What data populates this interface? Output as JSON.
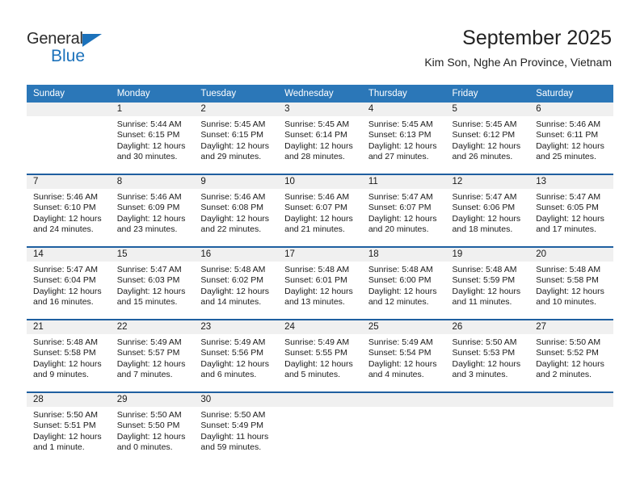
{
  "brand": {
    "name_top": "General",
    "name_bottom": "Blue",
    "triangle_color": "#1c72bb",
    "text_color": "#2b2b2b"
  },
  "header": {
    "title": "September 2025",
    "subtitle": "Kim Son, Nghe An Province, Vietnam"
  },
  "theme": {
    "header_bg": "#2b77b8",
    "row_divider": "#1f5fa0",
    "daynum_bg": "#f0f0f0",
    "page_bg": "#ffffff"
  },
  "columns": [
    "Sunday",
    "Monday",
    "Tuesday",
    "Wednesday",
    "Thursday",
    "Friday",
    "Saturday"
  ],
  "labels": {
    "sunrise_prefix": "Sunrise:",
    "sunset_prefix": "Sunset:",
    "daylight_prefix": "Daylight:"
  },
  "weeks": [
    [
      {
        "day": "",
        "sunrise": "",
        "sunset": "",
        "daylight": ""
      },
      {
        "day": "1",
        "sunrise": "Sunrise: 5:44 AM",
        "sunset": "Sunset: 6:15 PM",
        "daylight": "Daylight: 12 hours and 30 minutes."
      },
      {
        "day": "2",
        "sunrise": "Sunrise: 5:45 AM",
        "sunset": "Sunset: 6:15 PM",
        "daylight": "Daylight: 12 hours and 29 minutes."
      },
      {
        "day": "3",
        "sunrise": "Sunrise: 5:45 AM",
        "sunset": "Sunset: 6:14 PM",
        "daylight": "Daylight: 12 hours and 28 minutes."
      },
      {
        "day": "4",
        "sunrise": "Sunrise: 5:45 AM",
        "sunset": "Sunset: 6:13 PM",
        "daylight": "Daylight: 12 hours and 27 minutes."
      },
      {
        "day": "5",
        "sunrise": "Sunrise: 5:45 AM",
        "sunset": "Sunset: 6:12 PM",
        "daylight": "Daylight: 12 hours and 26 minutes."
      },
      {
        "day": "6",
        "sunrise": "Sunrise: 5:46 AM",
        "sunset": "Sunset: 6:11 PM",
        "daylight": "Daylight: 12 hours and 25 minutes."
      }
    ],
    [
      {
        "day": "7",
        "sunrise": "Sunrise: 5:46 AM",
        "sunset": "Sunset: 6:10 PM",
        "daylight": "Daylight: 12 hours and 24 minutes."
      },
      {
        "day": "8",
        "sunrise": "Sunrise: 5:46 AM",
        "sunset": "Sunset: 6:09 PM",
        "daylight": "Daylight: 12 hours and 23 minutes."
      },
      {
        "day": "9",
        "sunrise": "Sunrise: 5:46 AM",
        "sunset": "Sunset: 6:08 PM",
        "daylight": "Daylight: 12 hours and 22 minutes."
      },
      {
        "day": "10",
        "sunrise": "Sunrise: 5:46 AM",
        "sunset": "Sunset: 6:07 PM",
        "daylight": "Daylight: 12 hours and 21 minutes."
      },
      {
        "day": "11",
        "sunrise": "Sunrise: 5:47 AM",
        "sunset": "Sunset: 6:07 PM",
        "daylight": "Daylight: 12 hours and 20 minutes."
      },
      {
        "day": "12",
        "sunrise": "Sunrise: 5:47 AM",
        "sunset": "Sunset: 6:06 PM",
        "daylight": "Daylight: 12 hours and 18 minutes."
      },
      {
        "day": "13",
        "sunrise": "Sunrise: 5:47 AM",
        "sunset": "Sunset: 6:05 PM",
        "daylight": "Daylight: 12 hours and 17 minutes."
      }
    ],
    [
      {
        "day": "14",
        "sunrise": "Sunrise: 5:47 AM",
        "sunset": "Sunset: 6:04 PM",
        "daylight": "Daylight: 12 hours and 16 minutes."
      },
      {
        "day": "15",
        "sunrise": "Sunrise: 5:47 AM",
        "sunset": "Sunset: 6:03 PM",
        "daylight": "Daylight: 12 hours and 15 minutes."
      },
      {
        "day": "16",
        "sunrise": "Sunrise: 5:48 AM",
        "sunset": "Sunset: 6:02 PM",
        "daylight": "Daylight: 12 hours and 14 minutes."
      },
      {
        "day": "17",
        "sunrise": "Sunrise: 5:48 AM",
        "sunset": "Sunset: 6:01 PM",
        "daylight": "Daylight: 12 hours and 13 minutes."
      },
      {
        "day": "18",
        "sunrise": "Sunrise: 5:48 AM",
        "sunset": "Sunset: 6:00 PM",
        "daylight": "Daylight: 12 hours and 12 minutes."
      },
      {
        "day": "19",
        "sunrise": "Sunrise: 5:48 AM",
        "sunset": "Sunset: 5:59 PM",
        "daylight": "Daylight: 12 hours and 11 minutes."
      },
      {
        "day": "20",
        "sunrise": "Sunrise: 5:48 AM",
        "sunset": "Sunset: 5:58 PM",
        "daylight": "Daylight: 12 hours and 10 minutes."
      }
    ],
    [
      {
        "day": "21",
        "sunrise": "Sunrise: 5:48 AM",
        "sunset": "Sunset: 5:58 PM",
        "daylight": "Daylight: 12 hours and 9 minutes."
      },
      {
        "day": "22",
        "sunrise": "Sunrise: 5:49 AM",
        "sunset": "Sunset: 5:57 PM",
        "daylight": "Daylight: 12 hours and 7 minutes."
      },
      {
        "day": "23",
        "sunrise": "Sunrise: 5:49 AM",
        "sunset": "Sunset: 5:56 PM",
        "daylight": "Daylight: 12 hours and 6 minutes."
      },
      {
        "day": "24",
        "sunrise": "Sunrise: 5:49 AM",
        "sunset": "Sunset: 5:55 PM",
        "daylight": "Daylight: 12 hours and 5 minutes."
      },
      {
        "day": "25",
        "sunrise": "Sunrise: 5:49 AM",
        "sunset": "Sunset: 5:54 PM",
        "daylight": "Daylight: 12 hours and 4 minutes."
      },
      {
        "day": "26",
        "sunrise": "Sunrise: 5:50 AM",
        "sunset": "Sunset: 5:53 PM",
        "daylight": "Daylight: 12 hours and 3 minutes."
      },
      {
        "day": "27",
        "sunrise": "Sunrise: 5:50 AM",
        "sunset": "Sunset: 5:52 PM",
        "daylight": "Daylight: 12 hours and 2 minutes."
      }
    ],
    [
      {
        "day": "28",
        "sunrise": "Sunrise: 5:50 AM",
        "sunset": "Sunset: 5:51 PM",
        "daylight": "Daylight: 12 hours and 1 minute."
      },
      {
        "day": "29",
        "sunrise": "Sunrise: 5:50 AM",
        "sunset": "Sunset: 5:50 PM",
        "daylight": "Daylight: 12 hours and 0 minutes."
      },
      {
        "day": "30",
        "sunrise": "Sunrise: 5:50 AM",
        "sunset": "Sunset: 5:49 PM",
        "daylight": "Daylight: 11 hours and 59 minutes."
      },
      {
        "day": "",
        "sunrise": "",
        "sunset": "",
        "daylight": ""
      },
      {
        "day": "",
        "sunrise": "",
        "sunset": "",
        "daylight": ""
      },
      {
        "day": "",
        "sunrise": "",
        "sunset": "",
        "daylight": ""
      },
      {
        "day": "",
        "sunrise": "",
        "sunset": "",
        "daylight": ""
      }
    ]
  ]
}
